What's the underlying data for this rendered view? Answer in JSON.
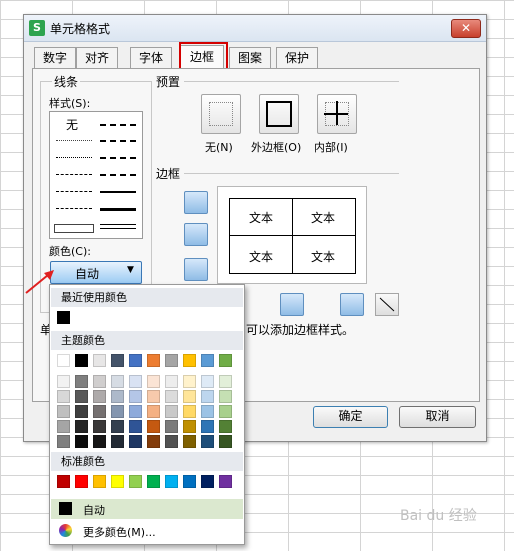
{
  "dialog": {
    "title": "单元格格式",
    "close_label": "✕"
  },
  "tabs": [
    {
      "label": "数字"
    },
    {
      "label": "对齐"
    },
    {
      "label": "字体"
    },
    {
      "label": "边框",
      "active": true
    },
    {
      "label": "图案"
    },
    {
      "label": "保护"
    }
  ],
  "line_group": {
    "title": "线条",
    "style_label": "样式(S):",
    "none_label": "无",
    "color_label": "颜色(C):",
    "color_value": "自动"
  },
  "preset_group": {
    "title": "预置",
    "none_label": "无(N)",
    "outline_label": "外边框(O)",
    "inside_label": "内部(I)"
  },
  "border_group": {
    "title": "边框",
    "cell_text": "文本",
    "hint_prefix": "单",
    "hint_suffix": "可以添加边框样式。"
  },
  "buttons": {
    "ok": "确定",
    "cancel": "取消"
  },
  "color_popup": {
    "recent_title": "最近使用颜色",
    "theme_title": "主题颜色",
    "standard_title": "标准颜色",
    "auto_label": "自动",
    "more_label": "更多颜色(M)...",
    "recent_colors": [
      "#000000"
    ],
    "theme_top": [
      "#ffffff",
      "#000000",
      "#e7e6e6",
      "#44546a",
      "#4472c4",
      "#ed7d31",
      "#a5a5a5",
      "#ffc000",
      "#5b9bd5",
      "#70ad47"
    ],
    "theme_shades": [
      [
        "#f2f2f2",
        "#7f7f7f",
        "#d0cece",
        "#d6dce4",
        "#d9e2f3",
        "#fbe4d5",
        "#ededed",
        "#fff2cc",
        "#deeaf6",
        "#e2efd9"
      ],
      [
        "#d8d8d8",
        "#595959",
        "#aeaaaa",
        "#adb9ca",
        "#b4c6e7",
        "#f7caac",
        "#dbdbdb",
        "#ffe599",
        "#bdd6ee",
        "#c5e0b3"
      ],
      [
        "#bfbfbf",
        "#3f3f3f",
        "#757070",
        "#8496b0",
        "#8eaadb",
        "#f4b083",
        "#c9c9c9",
        "#ffd966",
        "#9cc3e5",
        "#a8d08d"
      ],
      [
        "#a5a5a5",
        "#262626",
        "#3a3838",
        "#333f4f",
        "#2f5496",
        "#c45911",
        "#7b7b7b",
        "#bf8f00",
        "#2e75b5",
        "#538135"
      ],
      [
        "#7f7f7f",
        "#0c0c0c",
        "#171616",
        "#222a35",
        "#1f3763",
        "#833c0b",
        "#525252",
        "#7f6000",
        "#1e4e79",
        "#375623"
      ]
    ],
    "standard_colors": [
      "#c00000",
      "#ff0000",
      "#ffc000",
      "#ffff00",
      "#92d050",
      "#00b050",
      "#00b0f0",
      "#0070c0",
      "#002060",
      "#7030a0"
    ]
  },
  "watermark": "Bai du 经验"
}
